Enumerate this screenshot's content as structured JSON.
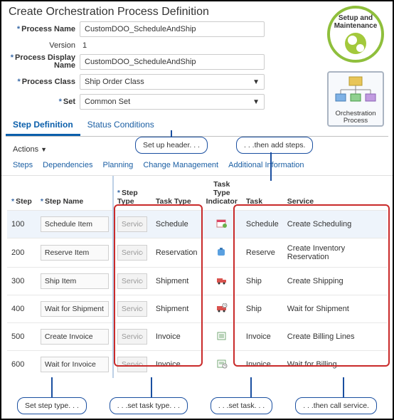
{
  "title": "Create Orchestration Process Definition",
  "form": {
    "process_name_lbl": "Process Name",
    "process_name_val": "CustomDOO_ScheduleAndShip",
    "version_lbl": "Version",
    "version_val": "1",
    "display_name_lbl": "Process Display Name",
    "display_name_val": "CustomDOO_ScheduleAndShip",
    "class_lbl": "Process Class",
    "class_val": "Ship Order Class",
    "set_lbl": "Set",
    "set_val": "Common Set"
  },
  "tabs": {
    "step_def": "Step Definition",
    "status_cond": "Status Conditions"
  },
  "callouts": {
    "header": "Set up header. . .",
    "add_steps": ". . .then add steps.",
    "step_type": "Set step type. . .",
    "task_type": ". . .set task type. . .",
    "task": ". . .set task. . .",
    "service": ". . .then call service."
  },
  "actions_label": "Actions",
  "subtabs": [
    "Steps",
    "Dependencies",
    "Planning",
    "Change Management",
    "Additional Information"
  ],
  "cols": {
    "step": "Step",
    "step_name": "Step Name",
    "step_type": "Step Type",
    "task_type": "Task Type",
    "indicator": "Task Type Indicator",
    "task": "Task",
    "service": "Service"
  },
  "rows": [
    {
      "step": "100",
      "name": "Schedule Item",
      "type": "Service",
      "ttype": "Schedule",
      "icon": "schedule",
      "task": "Schedule",
      "service": "Create Scheduling"
    },
    {
      "step": "200",
      "name": "Reserve Item",
      "type": "Service",
      "ttype": "Reservation",
      "icon": "reserve",
      "task": "Reserve",
      "service": "Create Inventory Reservation"
    },
    {
      "step": "300",
      "name": "Ship Item",
      "type": "Service",
      "ttype": "Shipment",
      "icon": "ship",
      "task": "Ship",
      "service": "Create Shipping"
    },
    {
      "step": "400",
      "name": "Wait for Shipment",
      "type": "Service",
      "ttype": "Shipment",
      "icon": "wait-ship",
      "task": "Ship",
      "service": "Wait for Shipment"
    },
    {
      "step": "500",
      "name": "Create Invoice",
      "type": "Service",
      "ttype": "Invoice",
      "icon": "invoice",
      "task": "Invoice",
      "service": "Create Billing Lines"
    },
    {
      "step": "600",
      "name": "Wait for Invoice",
      "type": "Service",
      "ttype": "Invoice",
      "icon": "wait-invoice",
      "task": "Invoice",
      "service": "Wait for Billing"
    }
  ],
  "side": {
    "setup_line1": "Setup and",
    "setup_line2": "Maintenance",
    "orch_line1": "Orchestration",
    "orch_line2": "Process"
  }
}
